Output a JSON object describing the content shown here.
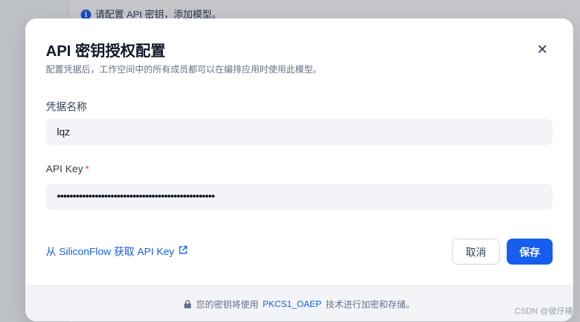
{
  "background": {
    "notice_text": "请配置 API 密钥，添加模型。"
  },
  "modal": {
    "title": "API 密钥授权配置",
    "description": "配置凭据后，工作空间中的所有成员都可以在编排应用时使用此模型。",
    "close_icon": "close-icon",
    "fields": {
      "credential_name": {
        "label": "凭据名称",
        "value": "lqz"
      },
      "api_key": {
        "label": "API Key",
        "required_mark": "*",
        "value": "••••••••••••••••••••••••••••••••••••••••••••••••••"
      }
    },
    "get_key_link": "从 SiliconFlow 获取 API Key",
    "buttons": {
      "cancel": "取消",
      "save": "保存"
    },
    "footer": {
      "prefix": "您的密钥将使用",
      "algorithm": "PKCS1_OAEP",
      "suffix": "技术进行加密和存储。"
    }
  },
  "watermark": "CSDN @彼仔椿",
  "colors": {
    "primary": "#155eef",
    "required": "#f04438"
  }
}
